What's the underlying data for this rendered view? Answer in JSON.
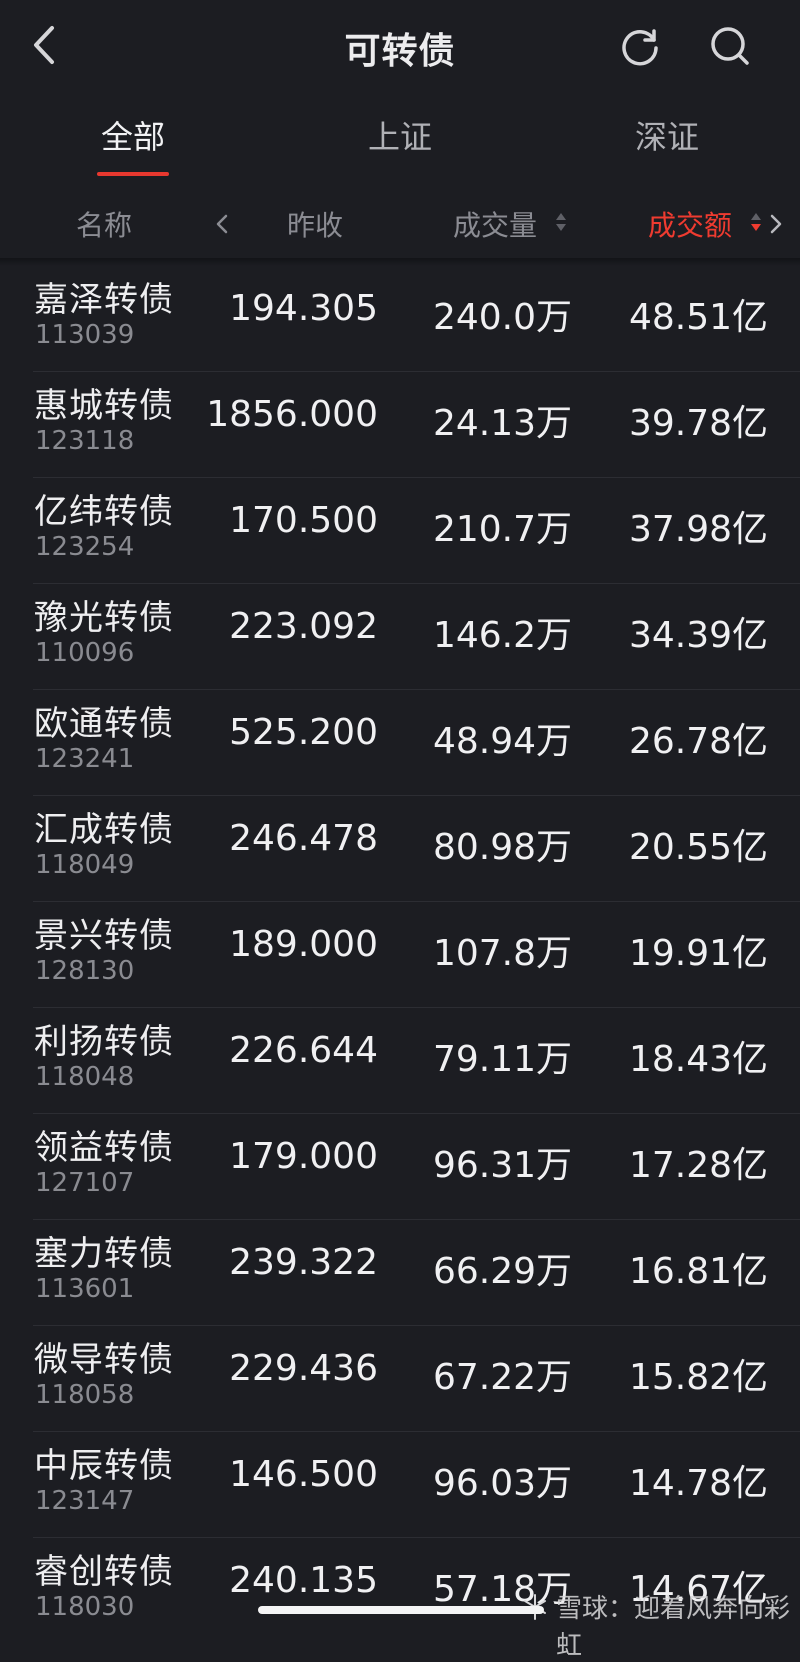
{
  "header": {
    "title": "可转债"
  },
  "tabs": [
    {
      "label": "全部",
      "active": true
    },
    {
      "label": "上证",
      "active": false
    },
    {
      "label": "深证",
      "active": false
    }
  ],
  "columns": {
    "name": "名称",
    "prev_close": "昨收",
    "volume": "成交量",
    "turnover": "成交额"
  },
  "rows": [
    {
      "name": "嘉泽转债",
      "code": "113039",
      "prev_close": "194.305",
      "volume": "240.0万",
      "turnover": "48.51亿"
    },
    {
      "name": "惠城转债",
      "code": "123118",
      "prev_close": "1856.000",
      "volume": "24.13万",
      "turnover": "39.78亿"
    },
    {
      "name": "亿纬转债",
      "code": "123254",
      "prev_close": "170.500",
      "volume": "210.7万",
      "turnover": "37.98亿"
    },
    {
      "name": "豫光转债",
      "code": "110096",
      "prev_close": "223.092",
      "volume": "146.2万",
      "turnover": "34.39亿"
    },
    {
      "name": "欧通转债",
      "code": "123241",
      "prev_close": "525.200",
      "volume": "48.94万",
      "turnover": "26.78亿"
    },
    {
      "name": "汇成转债",
      "code": "118049",
      "prev_close": "246.478",
      "volume": "80.98万",
      "turnover": "20.55亿"
    },
    {
      "name": "景兴转债",
      "code": "128130",
      "prev_close": "189.000",
      "volume": "107.8万",
      "turnover": "19.91亿"
    },
    {
      "name": "利扬转债",
      "code": "118048",
      "prev_close": "226.644",
      "volume": "79.11万",
      "turnover": "18.43亿"
    },
    {
      "name": "领益转债",
      "code": "127107",
      "prev_close": "179.000",
      "volume": "96.31万",
      "turnover": "17.28亿"
    },
    {
      "name": "塞力转债",
      "code": "113601",
      "prev_close": "239.322",
      "volume": "66.29万",
      "turnover": "16.81亿"
    },
    {
      "name": "微导转债",
      "code": "118058",
      "prev_close": "229.436",
      "volume": "67.22万",
      "turnover": "15.82亿"
    },
    {
      "name": "中辰转债",
      "code": "123147",
      "prev_close": "146.500",
      "volume": "96.03万",
      "turnover": "14.78亿"
    },
    {
      "name": "睿创转债",
      "code": "118030",
      "prev_close": "240.135",
      "volume": "57.18万",
      "turnover": "14.67亿"
    }
  ],
  "watermark": "雪球：迎着风奔向彩虹",
  "colors": {
    "accent": "#e8382f",
    "background": "#1c1d22"
  },
  "icons": {
    "back": "back-arrow-icon",
    "refresh": "refresh-icon",
    "search": "search-icon"
  }
}
